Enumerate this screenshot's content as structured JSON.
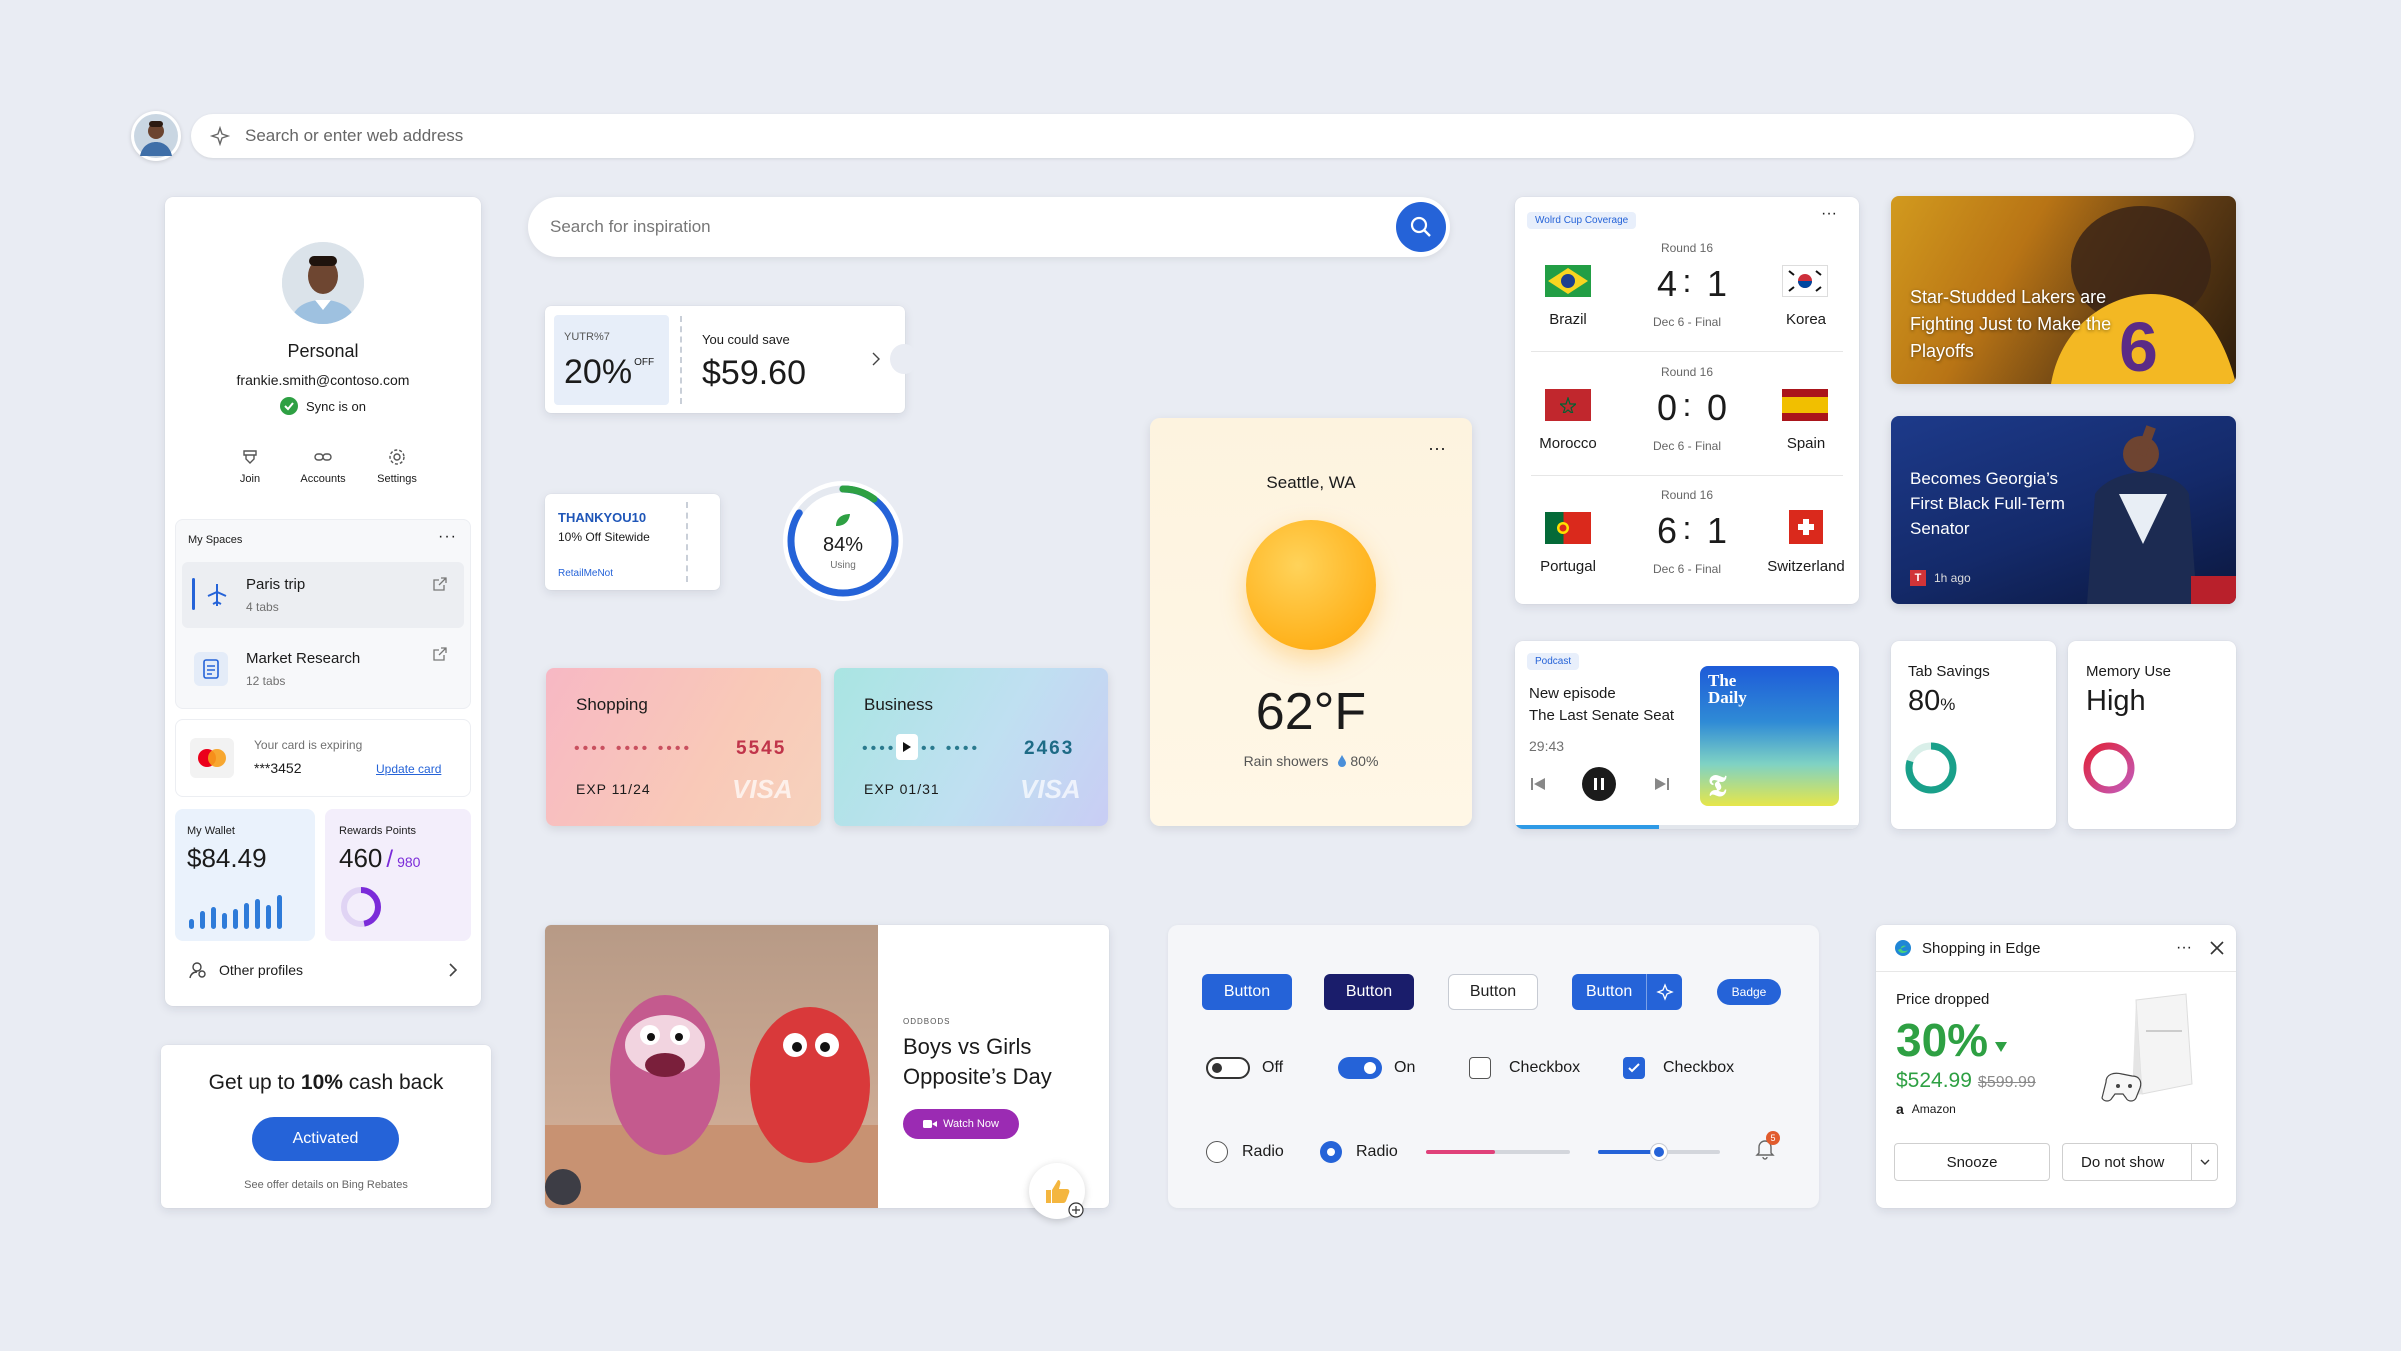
{
  "address_bar": {
    "placeholder": "Search or enter web address"
  },
  "profile": {
    "name": "Personal",
    "email": "frankie.smith@contoso.com",
    "sync": "Sync is on",
    "actions": [
      {
        "label": "Join",
        "icon": "join-icon"
      },
      {
        "label": "Accounts",
        "icon": "link-icon"
      },
      {
        "label": "Settings",
        "icon": "gear-icon"
      }
    ],
    "spaces_title": "My Spaces",
    "spaces": [
      {
        "title": "Paris trip",
        "sub": "4 tabs"
      },
      {
        "title": "Market Research",
        "sub": "12 tabs"
      }
    ],
    "card_expiring": "Your card is expiring",
    "card_number": "***3452",
    "update_card": "Update card",
    "wallet_label": "My Wallet",
    "wallet_value": "$84.49",
    "rewards_label": "Rewards Points",
    "rewards_value": "460",
    "rewards_total": "980",
    "rewards_fraction": 0.47,
    "other_profiles": "Other profiles"
  },
  "cashback": {
    "prefix": "Get up to ",
    "bold": "10%",
    "suffix": " cash back",
    "button": "Activated",
    "note": "See offer details on Bing Rebates"
  },
  "inspiration": {
    "placeholder": "Search for inspiration"
  },
  "coupon": {
    "code": "YUTR%7",
    "percent": "20%",
    "off": "OFF",
    "save_label": "You could save",
    "save_value": "$59.60"
  },
  "promo": {
    "code": "THANKYOU10",
    "desc": "10% Off Sitewide",
    "source": "RetailMeNot"
  },
  "usage_ring": {
    "percent": "84%",
    "label": "Using",
    "value": 0.84
  },
  "cards": [
    {
      "title": "Shopping",
      "last4": "5545",
      "exp": "EXP 11/24",
      "brand": "VISA"
    },
    {
      "title": "Business",
      "last4": "2463",
      "exp": "EXP 01/31",
      "brand": "VISA"
    }
  ],
  "video": {
    "eyebrow": "ODDBODS",
    "title1": "Boys vs Girls",
    "title2": "Opposite’s Day",
    "button": "Watch Now"
  },
  "weather": {
    "city": "Seattle, WA",
    "temp": "62°F",
    "desc": "Rain showers",
    "precip": "80%"
  },
  "worldcup": {
    "tag": "Wolrd Cup Coverage",
    "matches": [
      {
        "round": "Round 16",
        "home": "Brazil",
        "away": "Korea",
        "hs": "4",
        "as": "1",
        "status": "Dec 6 - Final"
      },
      {
        "round": "Round 16",
        "home": "Morocco",
        "away": "Spain",
        "hs": "0",
        "as": "0",
        "status": "Dec 6 - Final"
      },
      {
        "round": "Round 16",
        "home": "Portugal",
        "away": "Switzerland",
        "hs": "6",
        "as": "1",
        "status": "Dec 6 - Final"
      }
    ]
  },
  "news": [
    {
      "headline": "Star-Studded Lakers are Fighting Just to Make the Playoffs"
    },
    {
      "headline": "Becomes Georgia’s First Black Full-Term Senator",
      "time": "1h ago"
    }
  ],
  "podcast": {
    "tag": "Podcast",
    "line1": "New episode",
    "line2": "The Last Senate Seat",
    "time": "29:43",
    "art_title": "The Daily",
    "progress": 0.42
  },
  "tab_savings": {
    "label": "Tab Savings",
    "value": "80",
    "unit": "%",
    "fraction": 0.8
  },
  "memory": {
    "label": "Memory Use",
    "value": "High"
  },
  "controls": {
    "buttons": [
      "Button",
      "Button",
      "Button",
      "Button"
    ],
    "badge": "Badge",
    "toggle_off": "Off",
    "toggle_on": "On",
    "checkbox1": "Checkbox",
    "checkbox2": "Checkbox",
    "radio1": "Radio",
    "radio2": "Radio",
    "notif_count": "5",
    "slider1": 0.48,
    "slider2": 0.5
  },
  "shopping_edge": {
    "title": "Shopping in Edge",
    "price_label": "Price dropped",
    "percent": "30%",
    "price": "$524.99",
    "old_price": "$599.99",
    "store": "Amazon",
    "snooze": "Snooze",
    "dismiss": "Do not show"
  },
  "colors": {
    "accent": "#2563d8",
    "green": "#2ea043",
    "red": "#d13438",
    "purple": "#7b2bd9"
  }
}
